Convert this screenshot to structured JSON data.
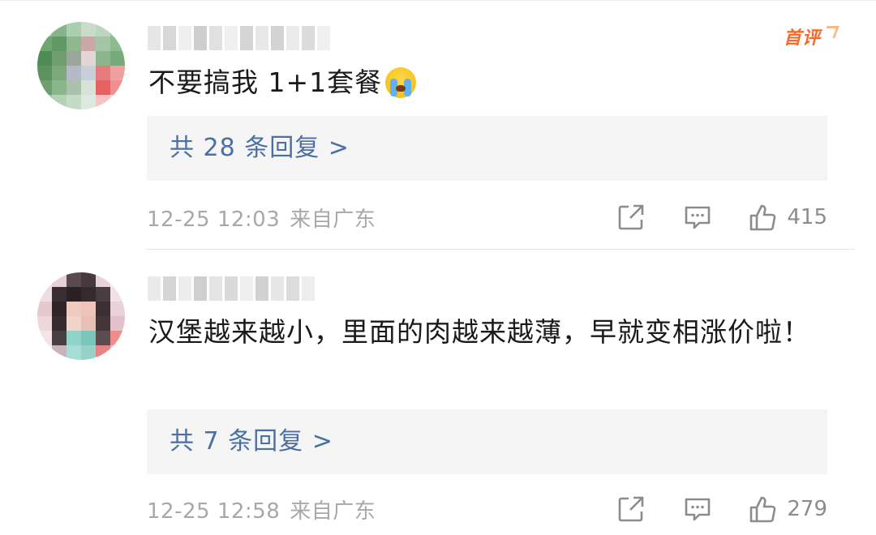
{
  "comments": [
    {
      "badge": "首评",
      "text": "不要搞我 1+1套餐",
      "replies_label": "共 28 条回复 >",
      "date": "12-25 12:03",
      "location": "来自广东",
      "likes": "415",
      "emoji": "crying-face"
    },
    {
      "text": "汉堡越来越小，里面的肉越来越薄，早就变相涨价啦！",
      "replies_label": "共 7 条回复 >",
      "date": "12-25 12:58",
      "location": "来自广东",
      "likes": "279"
    }
  ],
  "colors": {
    "reply_link": "#4a6fa5",
    "badge": "#f26b2b",
    "meta": "#a8a8a8",
    "reply_bg": "#f5f5f5"
  }
}
